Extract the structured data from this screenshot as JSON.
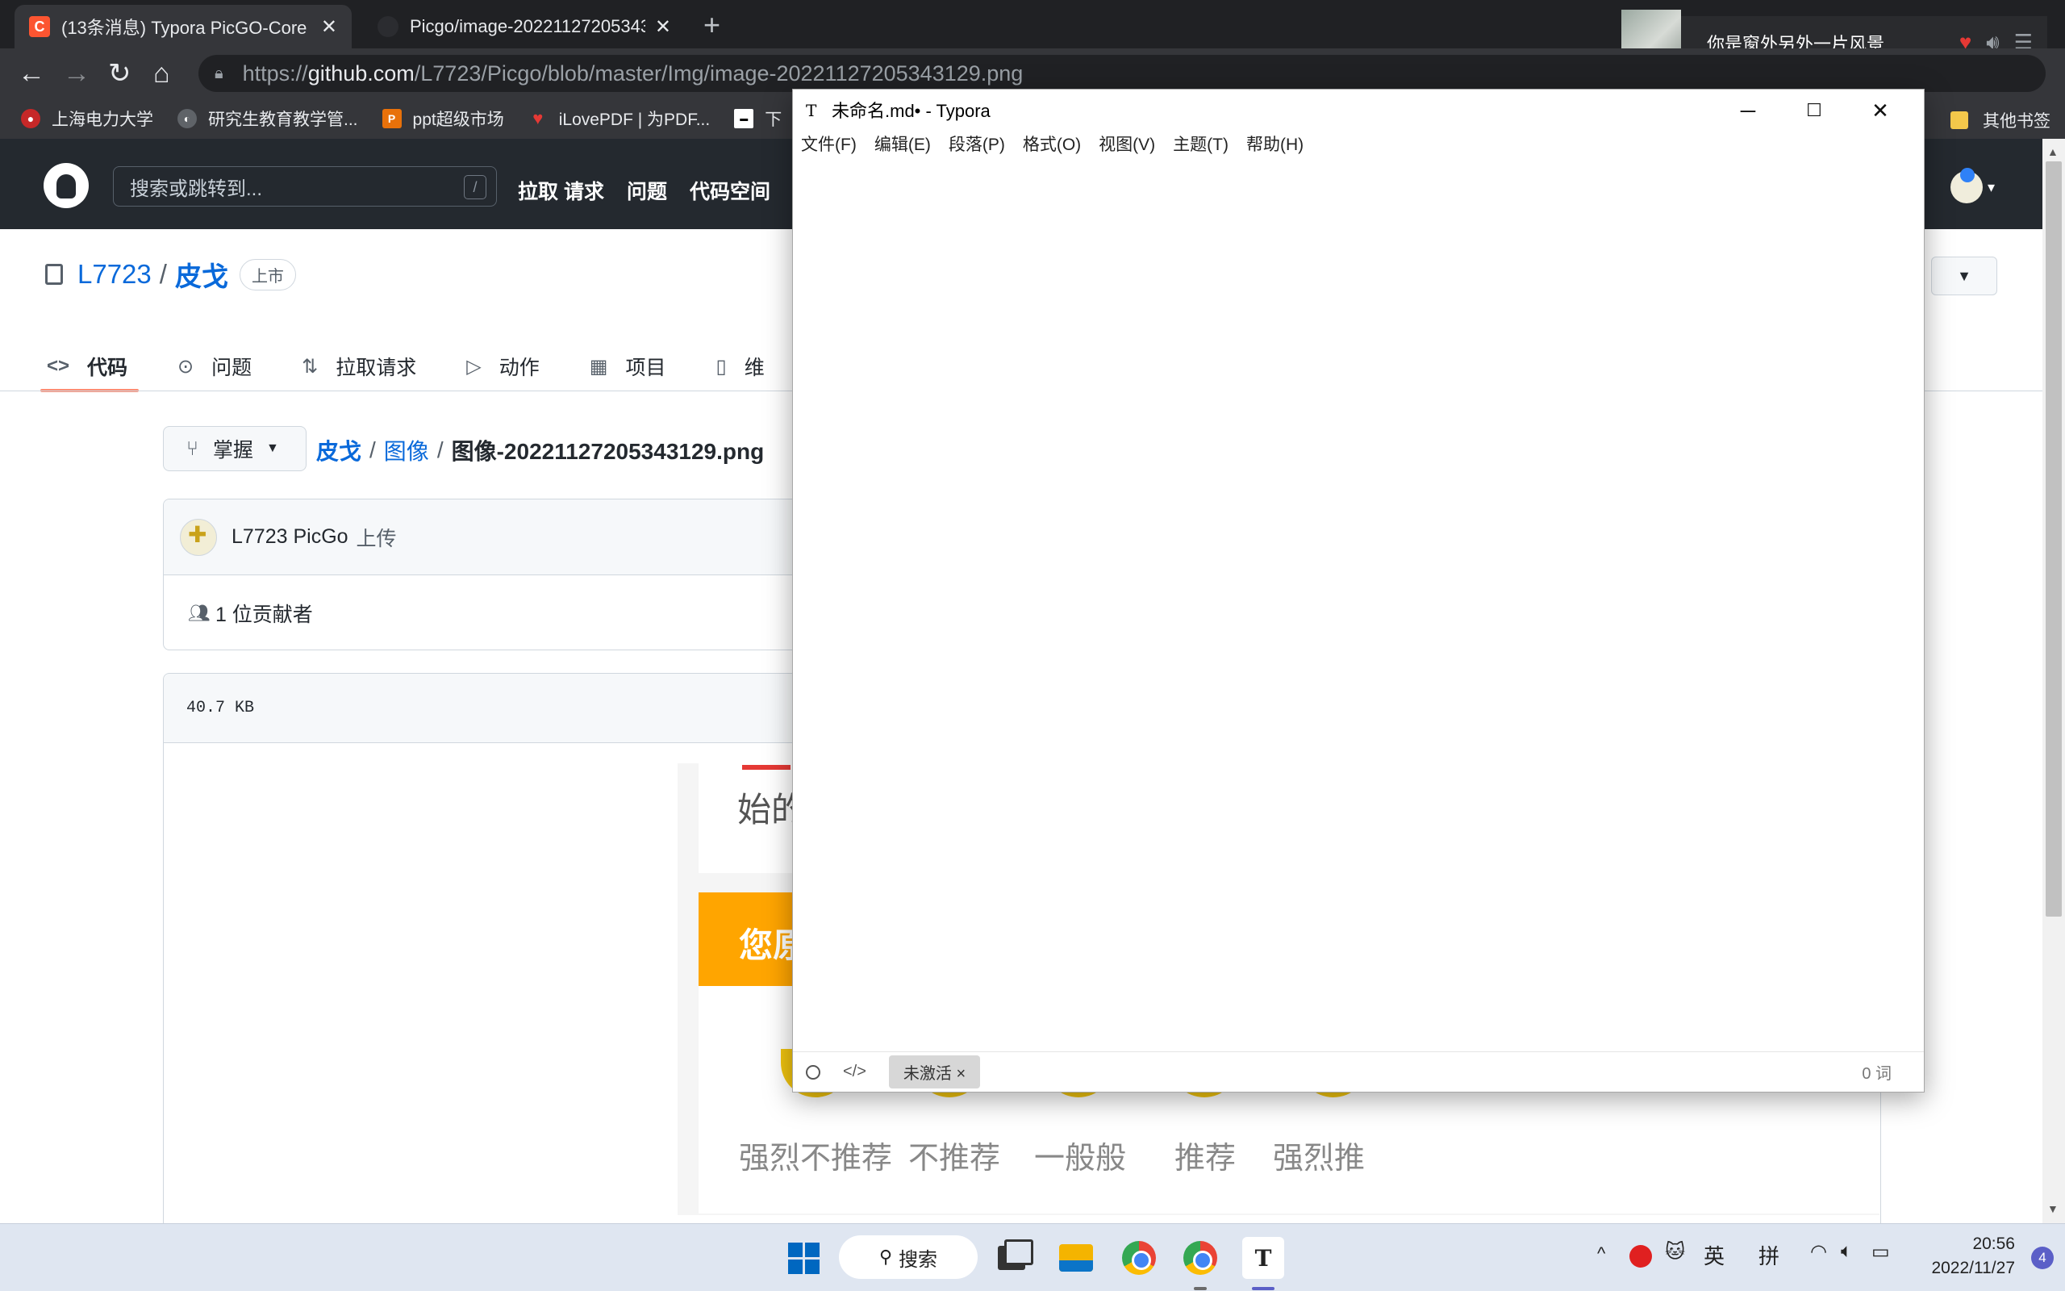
{
  "browser": {
    "tabs": [
      {
        "title": "(13条消息) Typora PicGO-Core",
        "favicon_color": "#fc5531",
        "favicon_letter": "C"
      },
      {
        "title": "Picgo/image-20221127205343",
        "favicon_color": "#202124",
        "favicon_letter": ""
      }
    ],
    "url_scheme": "https://",
    "url_host": "github.com",
    "url_path": "/L7723/Picgo/blob/master/Img/image-20221127205343129.png",
    "bookmarks": [
      "上海电力大学",
      "研究生教育教学管...",
      "ppt超级市场",
      "iLovePDF | 为PDF...",
      "下"
    ],
    "other_bookmarks": "其他书签",
    "media": {
      "title": "你是窗外另外一片风景"
    }
  },
  "github": {
    "search_placeholder": "搜索或跳转到...",
    "search_shortcut": "/",
    "nav": [
      "拉取 请求",
      "问题",
      "代码空间"
    ],
    "repo_owner": "L7723",
    "repo_name": "皮戈",
    "repo_badge": "上市",
    "tabs": [
      "代码",
      "问题",
      "拉取请求",
      "动作",
      "项目",
      "维"
    ],
    "branch": "掌握",
    "path_repo": "皮戈",
    "path_dir": "图像",
    "path_file": "图像-20221127205343129.png",
    "commit_user": "L7723 PicGo",
    "commit_action": "上传",
    "contributors": "1 位贡献者",
    "file_size": "40.7 KB",
    "preview": {
      "text_top": "始的",
      "band_text": "您原",
      "ratings": [
        "强烈不推荐",
        "不推荐",
        "一般般",
        "推荐",
        "强烈推"
      ]
    }
  },
  "typora": {
    "title": "未命名.md• - Typora",
    "menu": [
      "文件(F)",
      "编辑(E)",
      "段落(P)",
      "格式(O)",
      "视图(V)",
      "主题(T)",
      "帮助(H)"
    ],
    "badge": "未激活 ×",
    "word_count": "0 词"
  },
  "taskbar": {
    "search_label": "搜索",
    "ime_lang": "英",
    "ime_mode": "拼",
    "time": "20:56",
    "date": "2022/11/27",
    "notifications": "4"
  }
}
